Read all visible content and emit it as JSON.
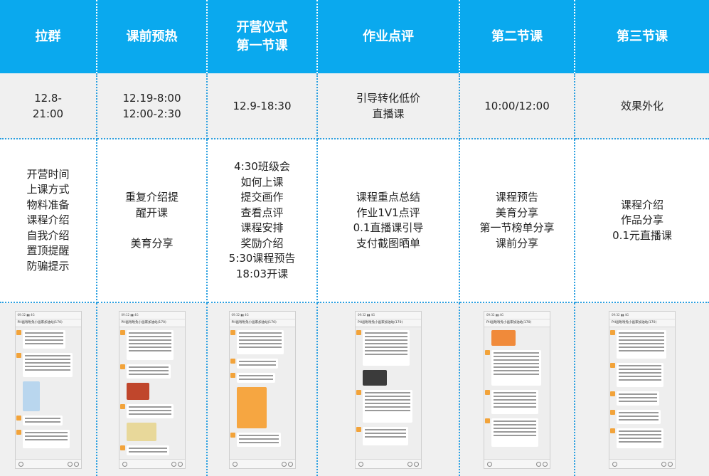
{
  "header": [
    "拉群",
    "课前预热",
    "开营仪式\n第一节课",
    "作业点评",
    "第二节课",
    "第三节课"
  ],
  "times": [
    "12.8-\n21:00",
    "12.19-8:00\n12:00-2:30",
    "12.9-18:30",
    "引导转化低价\n直播课",
    "10:00/12:00",
    "效果外化"
  ],
  "content": [
    "开营时间\n上课方式\n物料准备\n课程介绍\n自我介绍\n置顶提醒\n防骗提示",
    "重复介绍提\n醒开课\n\n美育分享",
    "4:30班级会\n如何上课\n提交画作\n查看点评\n课程安排\n奖励介绍\n5:30课程预告\n18:03开课",
    "课程重点总结\n作业1V1点评\n0.1直播课引导\n支付截图晒单",
    "课程预告\n美育分享\n第一节榜单分享\n课前分享",
    "课程介绍\n作品分享\n0.1元直播课"
  ],
  "screenshots": [
    {
      "group": "PH画啦啦兔小画家加油站(170)",
      "images": [
        "#b9d6ee"
      ]
    },
    {
      "group": "PH画啦啦兔小画家加油站(170)",
      "images": [
        "#c0462c",
        "#e8d89a"
      ]
    },
    {
      "group": "PH画啦啦兔小画家加油站(170)",
      "images": [
        "#f6a641"
      ]
    },
    {
      "group": "PH画啦啦兔小画家加油站(170)",
      "images": [
        "#3b3b3b"
      ]
    },
    {
      "group": "PH画啦啦兔小画家加油站(170)",
      "images": [
        "#f08a3a"
      ]
    },
    {
      "group": "PH画啦啦兔小画家加油站(170)",
      "images": []
    }
  ],
  "colors": {
    "header_bg": "#0aa9ee",
    "divider": "#2a9fe0",
    "row_gray": "#f0f0f0"
  }
}
